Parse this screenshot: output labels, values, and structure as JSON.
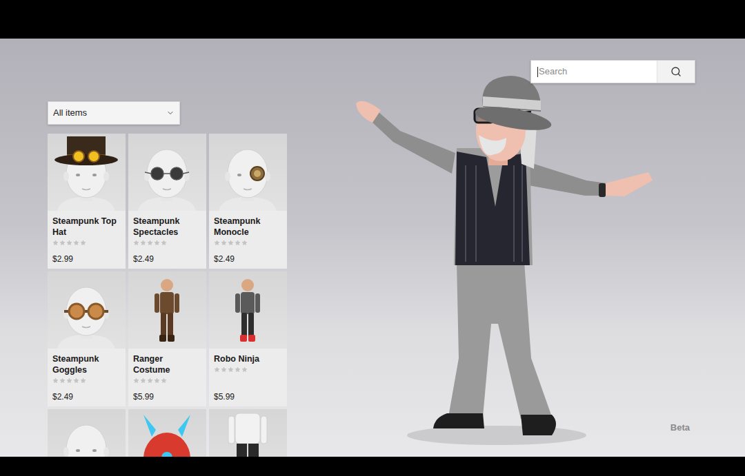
{
  "filter": {
    "label": "All items",
    "expanded": false
  },
  "search": {
    "placeholder": "Search"
  },
  "items": [
    {
      "name": "Steampunk Top Hat",
      "price": "$2.99",
      "stars": 0,
      "kind": "tophat"
    },
    {
      "name": "Steampunk Spectacles",
      "price": "$2.49",
      "stars": 0,
      "kind": "spectacles"
    },
    {
      "name": "Steampunk Monocle",
      "price": "$2.49",
      "stars": 0,
      "kind": "monocle"
    },
    {
      "name": "Steampunk Goggles",
      "price": "$2.49",
      "stars": 0,
      "kind": "goggles"
    },
    {
      "name": "Ranger Costume",
      "price": "$5.99",
      "stars": 0,
      "kind": "ranger"
    },
    {
      "name": "Robo Ninja",
      "price": "$5.99",
      "stars": 0,
      "kind": "ninja"
    },
    {
      "kind": "head"
    },
    {
      "kind": "helmet"
    },
    {
      "kind": "body"
    }
  ],
  "badge": "Beta"
}
